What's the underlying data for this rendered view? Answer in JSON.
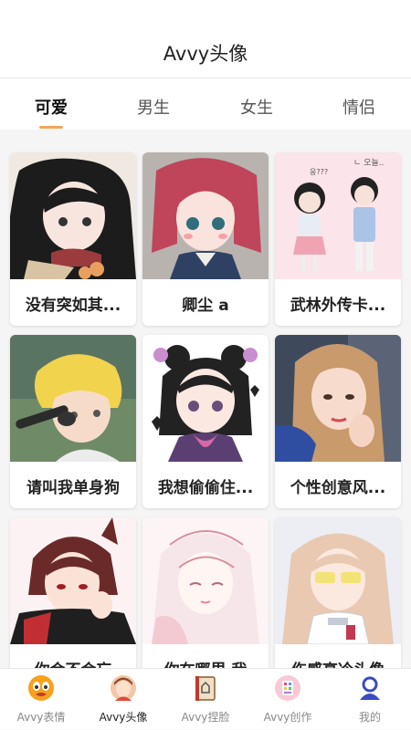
{
  "header": {
    "title": "Avvy头像"
  },
  "tabs": [
    {
      "label": "可爱",
      "active": true
    },
    {
      "label": "男生",
      "active": false
    },
    {
      "label": "女生",
      "active": false
    },
    {
      "label": "情侣",
      "active": false
    }
  ],
  "colors": {
    "accent": "#f3a55b"
  },
  "avatars": [
    {
      "name": "没有突如其..."
    },
    {
      "name": "卿尘 a"
    },
    {
      "name": "武林外传卡..."
    },
    {
      "name": "请叫我单身狗"
    },
    {
      "name": "我想偷偷住..."
    },
    {
      "name": "个性创意风..."
    },
    {
      "name": "你会不会忘"
    },
    {
      "name": "你在哪里 我"
    },
    {
      "name": "伤感高冷头像"
    }
  ],
  "bottom_nav": [
    {
      "label": "Avvy表情",
      "icon": "emoji-face-icon"
    },
    {
      "label": "Avvy头像",
      "icon": "avatar-icon",
      "active": true
    },
    {
      "label": "Avvy捏脸",
      "icon": "face-editor-icon"
    },
    {
      "label": "Avvy创作",
      "icon": "palette-icon"
    },
    {
      "label": "我的",
      "icon": "profile-icon"
    }
  ]
}
